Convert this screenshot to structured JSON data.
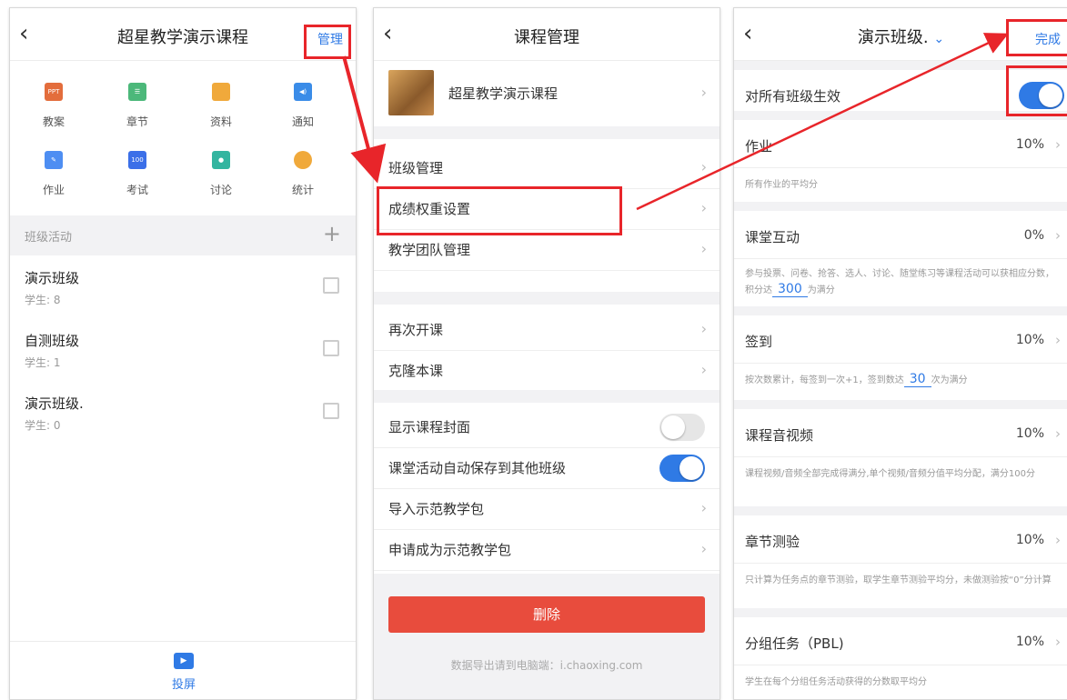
{
  "p1": {
    "back": "‹",
    "title": "超星教学演示课程",
    "manage": "管理",
    "icons": [
      {
        "label": "教案",
        "icon": "ppt-icon",
        "glyph": "PPT",
        "color": "#e36d3c"
      },
      {
        "label": "章节",
        "icon": "list-icon",
        "glyph": "☰",
        "color": "#4cb87a"
      },
      {
        "label": "资料",
        "icon": "folder-icon",
        "glyph": "",
        "color": "#f0a93b"
      },
      {
        "label": "通知",
        "icon": "speaker-icon",
        "glyph": "◀)",
        "color": "#3a8ce8"
      },
      {
        "label": "作业",
        "icon": "edit-icon",
        "glyph": "✎",
        "color": "#4e8ef2"
      },
      {
        "label": "考试",
        "icon": "exam-icon",
        "glyph": "100",
        "color": "#3b6fe8"
      },
      {
        "label": "讨论",
        "icon": "chat-icon",
        "glyph": "●",
        "color": "#33b5a0"
      },
      {
        "label": "统计",
        "icon": "pie-icon",
        "glyph": "",
        "color": "#f0a93b"
      }
    ],
    "section_title": "班级活动",
    "add": "+",
    "classes": [
      {
        "name": "演示班级",
        "students": "学生: 8"
      },
      {
        "name": "自测班级",
        "students": "学生: 1"
      },
      {
        "name": "演示班级.",
        "students": "学生: 0"
      }
    ],
    "cast_label": "投屏"
  },
  "p2": {
    "title": "课程管理",
    "course_name": "超星教学演示课程",
    "rows1": [
      "班级管理",
      "成绩权重设置",
      "教学团队管理"
    ],
    "rows2": [
      "再次开课",
      "克隆本课"
    ],
    "toggle_rows": [
      {
        "label": "显示课程封面",
        "on": false
      },
      {
        "label": "课堂活动自动保存到其他班级",
        "on": true
      }
    ],
    "rows3": [
      "导入示范教学包",
      "申请成为示范教学包"
    ],
    "delete_label": "删除",
    "footer_note": "数据导出请到电脑端：i.chaoxing.com"
  },
  "p3": {
    "title": "演示班级.",
    "title_arrow": "⌄",
    "done": "完成",
    "apply_all": "对所有班级生效",
    "items": [
      {
        "name": "作业",
        "pct": "10%",
        "desc_pre": "所有作业的平均分",
        "value": "",
        "desc_post": ""
      },
      {
        "name": "课堂互动",
        "pct": "0%",
        "desc_pre": "参与投票、问卷、抢答、选人、讨论、随堂练习等课程活动可以获相应分数，积分达",
        "value": "300",
        "desc_post": "为满分"
      },
      {
        "name": "签到",
        "pct": "10%",
        "desc_pre": "按次数累计，每签到一次+1，签到数达",
        "value": "30",
        "desc_post": "次为满分"
      },
      {
        "name": "课程音视频",
        "pct": "10%",
        "desc_pre": "课程视频/音频全部完成得满分,单个视频/音频分值平均分配，满分100分",
        "value": "",
        "desc_post": ""
      },
      {
        "name": "章节测验",
        "pct": "10%",
        "desc_pre": "只计算为任务点的章节测验，取学生章节测验平均分，未做测验按“0”分计算",
        "value": "",
        "desc_post": ""
      },
      {
        "name": "分组任务（PBL)",
        "pct": "10%",
        "desc_pre": "学生在每个分组任务活动获得的分数取平均分",
        "value": "",
        "desc_post": ""
      }
    ]
  },
  "colors": {
    "accent": "#2f7ae5",
    "highlight": "#e8252a",
    "delete": "#e84c3d"
  }
}
